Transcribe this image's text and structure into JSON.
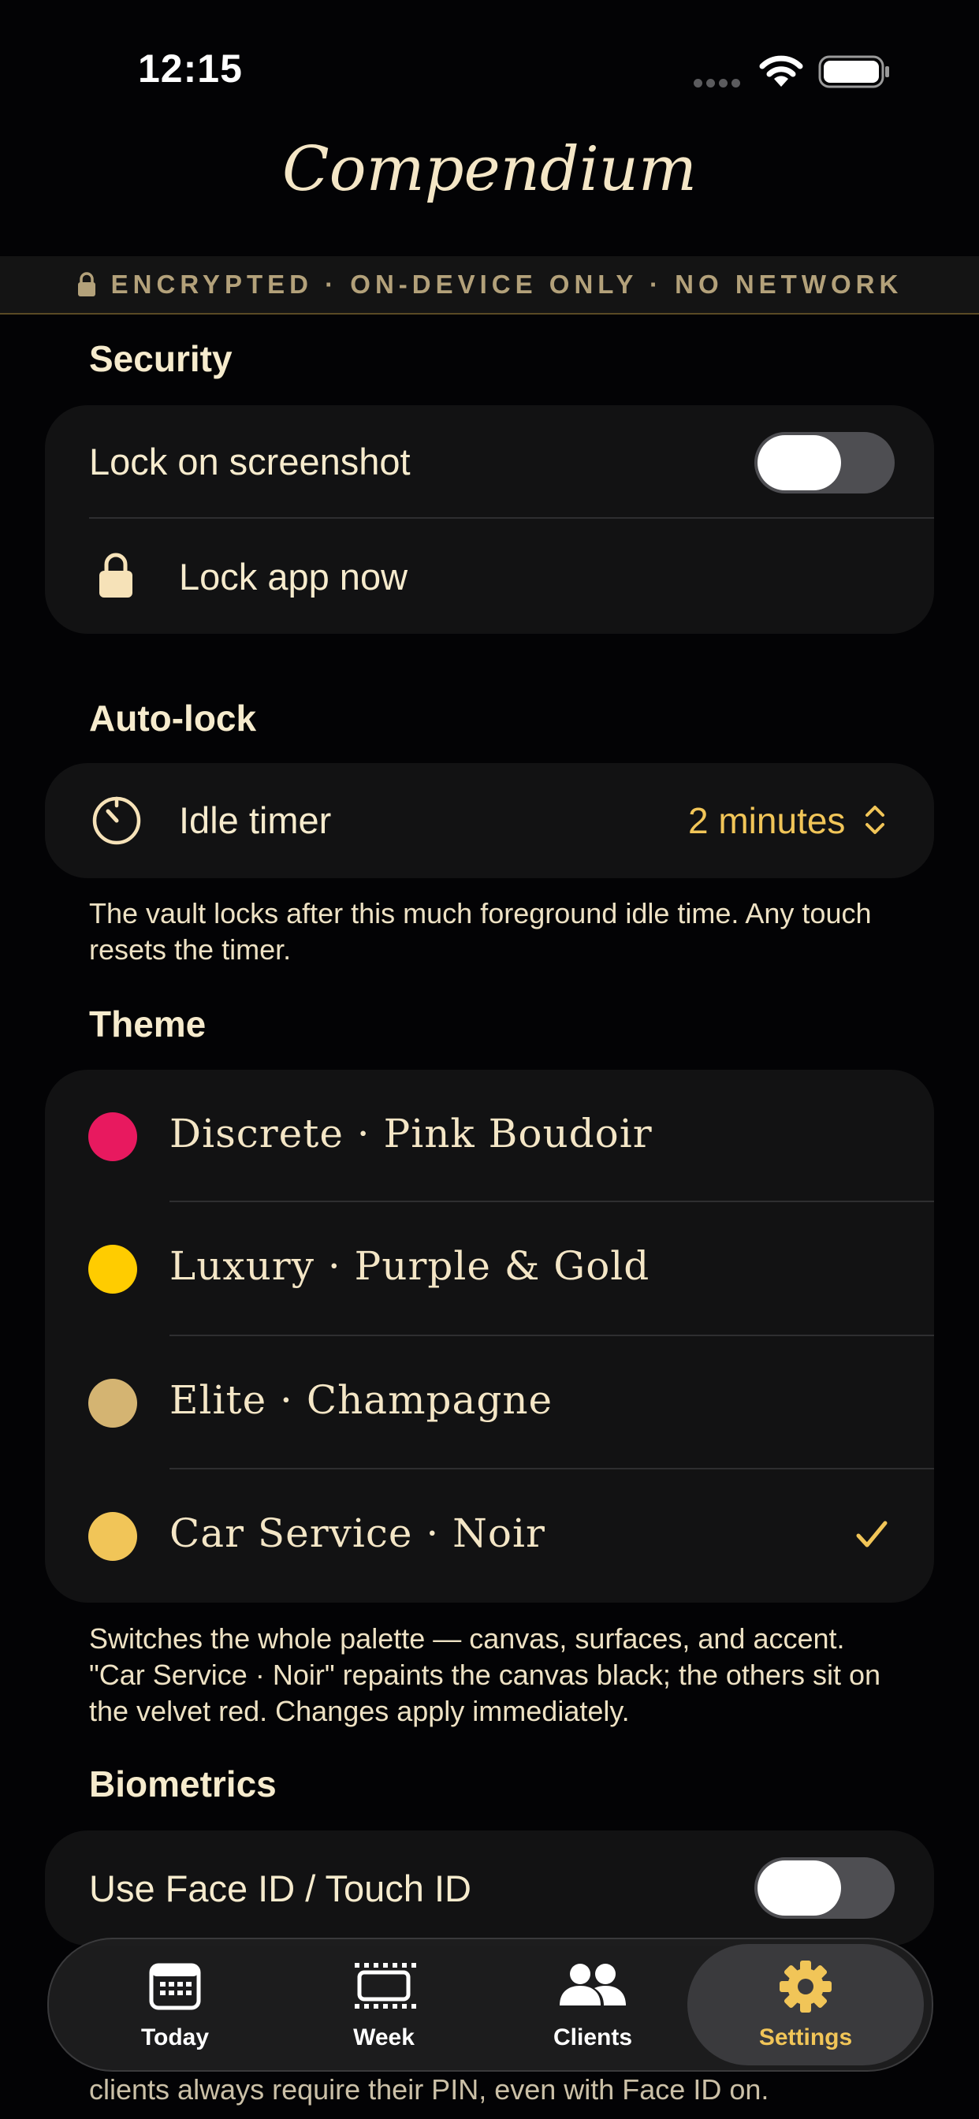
{
  "status_bar": {
    "time": "12:15"
  },
  "app": {
    "title": "Compendium"
  },
  "banner": {
    "text": "ENCRYPTED · ON-DEVICE ONLY · NO NETWORK",
    "icon": "lock-icon"
  },
  "security": {
    "heading": "Security",
    "lock_on_screenshot_label": "Lock on screenshot",
    "lock_on_screenshot_on": false,
    "lock_app_now_label": "Lock app now"
  },
  "auto_lock": {
    "heading": "Auto-lock",
    "idle_timer_label": "Idle timer",
    "idle_timer_value": "2 minutes",
    "footnote": "The vault locks after this much foreground idle time. Any touch resets the timer."
  },
  "theme": {
    "heading": "Theme",
    "options": [
      {
        "label": "Discrete · Pink Boudoir",
        "color": "#E8195F",
        "selected": false
      },
      {
        "label": "Luxury · Purple & Gold",
        "color": "#FFCC00",
        "selected": false
      },
      {
        "label": "Elite · Champagne",
        "color": "#D4B472",
        "selected": false
      },
      {
        "label": "Car Service · Noir",
        "color": "#F1C558",
        "selected": true
      }
    ],
    "footnote": "Switches the whole palette — canvas, surfaces, and accent. \"Car Service · Noir\" repaints the canvas black; the others sit on the velvet red. Changes apply immediately."
  },
  "biometrics": {
    "heading": "Biometrics",
    "face_id_label": "Use Face ID / Touch ID",
    "face_id_on": false,
    "footnote_tail": "clients always require their PIN, even with Face ID on."
  },
  "tabs": [
    {
      "label": "Today",
      "icon": "calendar-icon",
      "active": false
    },
    {
      "label": "Week",
      "icon": "week-icon",
      "active": false
    },
    {
      "label": "Clients",
      "icon": "people-icon",
      "active": false
    },
    {
      "label": "Settings",
      "icon": "gear-icon",
      "active": true
    }
  ],
  "colors": {
    "accent": "#F1C558",
    "background": "#030305",
    "surface": "#121213",
    "text": "#F6EBCD"
  }
}
